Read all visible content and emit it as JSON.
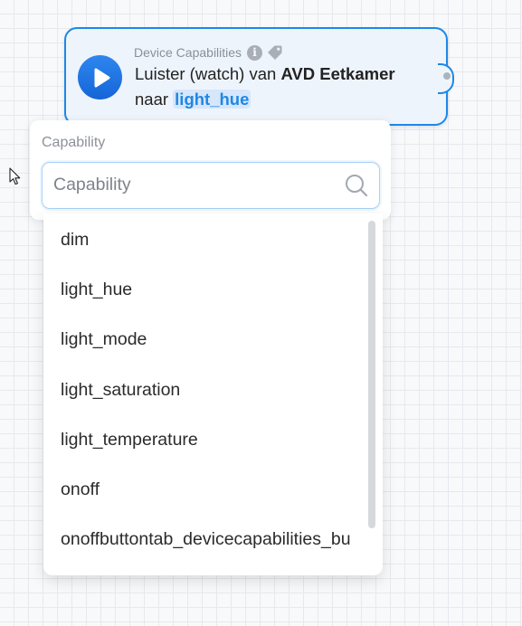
{
  "card": {
    "title": "Device Capabilities",
    "line1_prefix": "Luister (watch) van ",
    "device_name": "AVD Eetkamer",
    "line2_prefix": "naar ",
    "capability_token": "light_hue",
    "icons": [
      "play-icon",
      "info-icon",
      "tag-icon"
    ],
    "accent_color": "#1e88e5"
  },
  "search": {
    "label": "Capability",
    "placeholder": "Capability",
    "value": ""
  },
  "dropdown": {
    "items": [
      "dim",
      "light_hue",
      "light_mode",
      "light_saturation",
      "light_temperature",
      "onoff",
      "onoffbuttontab_devicecapabilities_bu"
    ]
  }
}
